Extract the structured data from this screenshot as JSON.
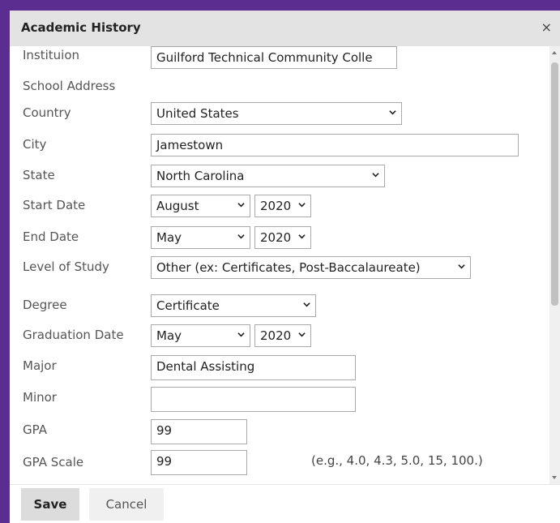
{
  "dialog": {
    "title": "Academic History",
    "close_symbol": "×",
    "save_label": "Save",
    "cancel_label": "Cancel"
  },
  "fields": {
    "institution": {
      "label": "Instituion",
      "value": "Guilford Technical Community Colle"
    },
    "school_address": {
      "label": "School Address"
    },
    "country": {
      "label": "Country",
      "value": "United States"
    },
    "city": {
      "label": "City",
      "value": "Jamestown"
    },
    "state": {
      "label": "State",
      "value": "North Carolina"
    },
    "start_date": {
      "label": "Start Date",
      "month": "August",
      "year": "2020"
    },
    "end_date": {
      "label": "End Date",
      "month": "May",
      "year": "2020"
    },
    "level_of_study": {
      "label": "Level of Study",
      "value": "Other (ex: Certificates, Post-Baccalaureate)"
    },
    "degree": {
      "label": "Degree",
      "value": "Certificate"
    },
    "graduation_date": {
      "label": "Graduation Date",
      "month": "May",
      "year": "2020"
    },
    "major": {
      "label": "Major",
      "value": "Dental Assisting"
    },
    "minor": {
      "label": "Minor",
      "value": ""
    },
    "gpa": {
      "label": "GPA",
      "value": "99"
    },
    "gpa_scale": {
      "label": "GPA Scale",
      "value": "99",
      "hint": "(e.g., 4.0, 4.3, 5.0, 15, 100.)"
    }
  },
  "icons": {
    "select_arrow": "chevron-down-icon",
    "close": "close-icon"
  },
  "colors": {
    "frame_border": "#5c2d91",
    "titlebar_bg": "#e3e3e3",
    "save_bg": "#dcdcdc",
    "cancel_bg": "#f0f0f0"
  }
}
